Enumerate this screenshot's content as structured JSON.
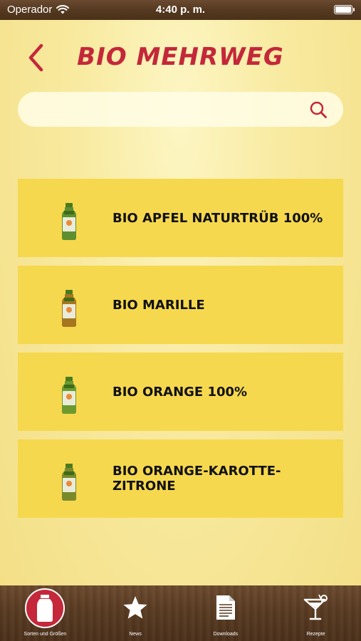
{
  "status_bar": {
    "carrier": "Operador",
    "time": "4:40 p. m."
  },
  "header": {
    "title": "BIO MEHRWEG"
  },
  "search": {
    "value": "",
    "placeholder": ""
  },
  "products": [
    {
      "name": "BIO APFEL NATURTRÜB 100%",
      "bottle_color": "#5e8f2e"
    },
    {
      "name": "BIO MARILLE",
      "bottle_color": "#a6761f"
    },
    {
      "name": "BIO ORANGE 100%",
      "bottle_color": "#6c9a2f"
    },
    {
      "name": "BIO ORANGE-KAROTTE-ZITRONE",
      "bottle_color": "#7a8a2a"
    }
  ],
  "tabs": [
    {
      "label": "Sorten und Größen",
      "icon": "bottle-icon",
      "active": true
    },
    {
      "label": "News",
      "icon": "star-icon",
      "active": false
    },
    {
      "label": "Downloads",
      "icon": "document-icon",
      "active": false
    },
    {
      "label": "Rezepte",
      "icon": "cocktail-icon",
      "active": false
    }
  ],
  "colors": {
    "accent": "#c3283a",
    "item_bg": "#f6d84e",
    "wood": "#5a3c22"
  }
}
